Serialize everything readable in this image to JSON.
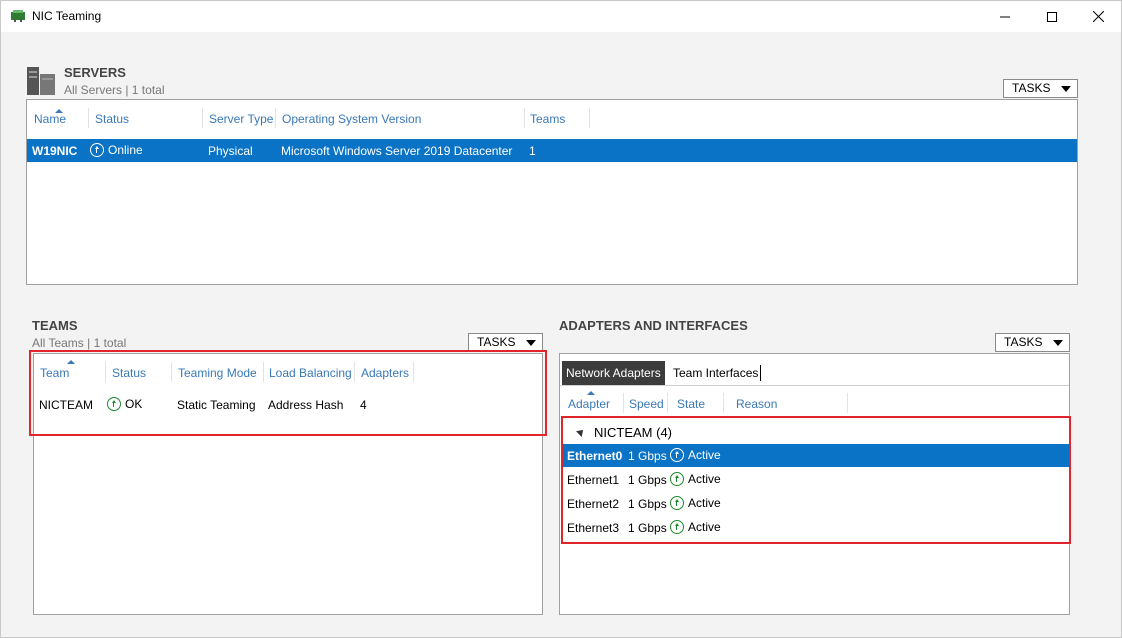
{
  "window": {
    "title": "NIC Teaming"
  },
  "servers": {
    "title": "SERVERS",
    "subtitle": "All Servers | 1 total",
    "tasks_label": "TASKS",
    "columns": [
      "Name",
      "Status",
      "Server Type",
      "Operating System Version",
      "Teams"
    ],
    "rows": [
      {
        "name": "W19NIC",
        "status": "Online",
        "server_type": "Physical",
        "os": "Microsoft Windows Server 2019 Datacenter",
        "teams": "1"
      }
    ]
  },
  "teams": {
    "title": "TEAMS",
    "subtitle": "All Teams | 1 total",
    "tasks_label": "TASKS",
    "columns": [
      "Team",
      "Status",
      "Teaming Mode",
      "Load Balancing",
      "Adapters"
    ],
    "rows": [
      {
        "team": "NICTEAM",
        "status": "OK",
        "mode": "Static Teaming",
        "load_balancing": "Address Hash",
        "adapters": "4"
      }
    ]
  },
  "adapters": {
    "title": "ADAPTERS AND INTERFACES",
    "tasks_label": "TASKS",
    "tabs": [
      "Network Adapters",
      "Team Interfaces"
    ],
    "columns": [
      "Adapter",
      "Speed",
      "State",
      "Reason"
    ],
    "group_label": "NICTEAM (4)",
    "rows": [
      {
        "adapter": "Ethernet0",
        "speed": "1 Gbps",
        "state": "Active"
      },
      {
        "adapter": "Ethernet1",
        "speed": "1 Gbps",
        "state": "Active"
      },
      {
        "adapter": "Ethernet2",
        "speed": "1 Gbps",
        "state": "Active"
      },
      {
        "adapter": "Ethernet3",
        "speed": "1 Gbps",
        "state": "Active"
      }
    ]
  },
  "icons": {
    "window_minimize": "minimize-icon",
    "window_maximize": "maximize-icon",
    "window_close": "close-icon",
    "status": "up-arrow-circle-icon"
  },
  "colors": {
    "selection": "#0a73c6",
    "header_text": "#3a79b8",
    "status_green": "#1f8a2f",
    "highlight_box": "#e0262b"
  }
}
